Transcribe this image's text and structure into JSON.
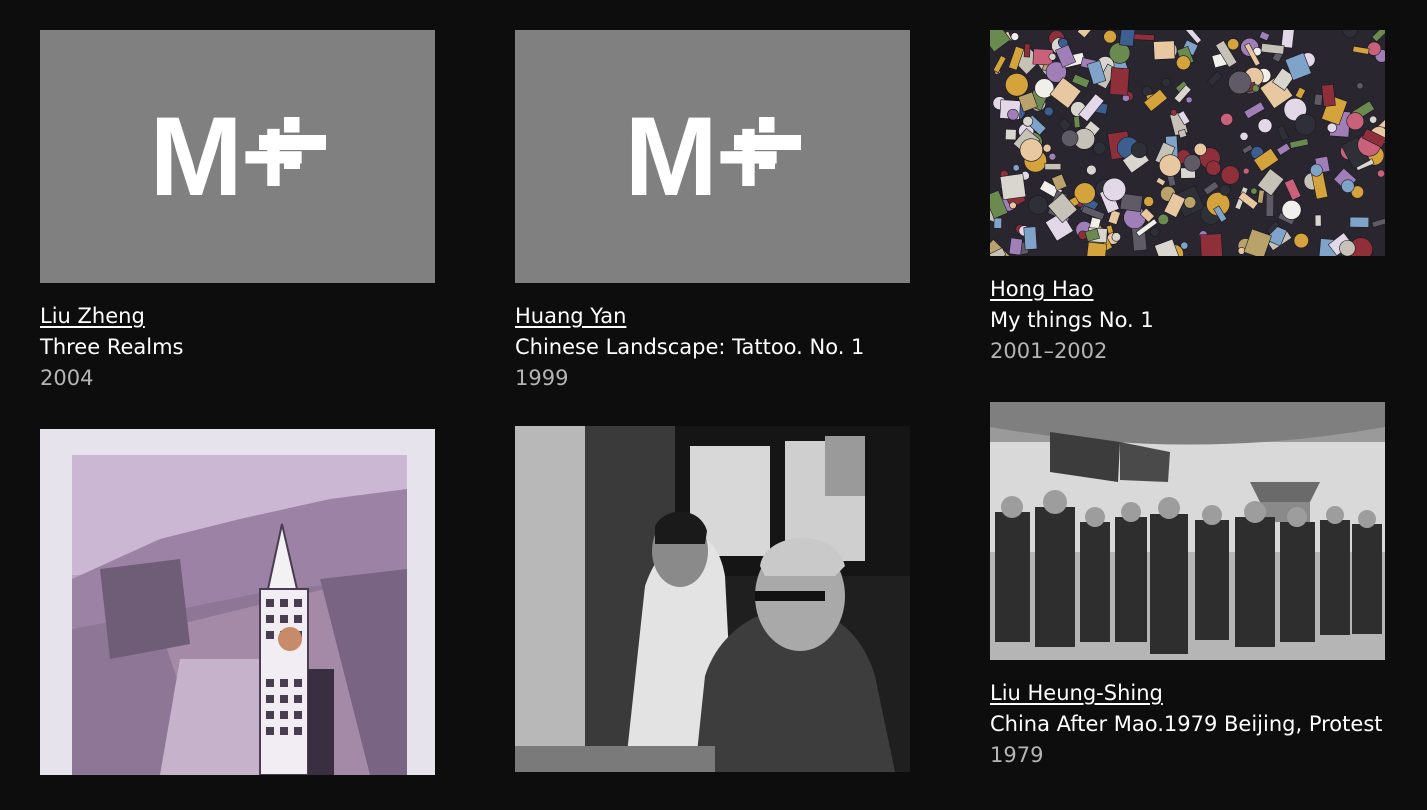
{
  "placeholder_logo": "M+",
  "colors": {
    "background": "#0d0d0d",
    "placeholder": "#808080",
    "text": "#ffffff",
    "year": "#b5b5b5"
  },
  "cards": [
    {
      "artist": "Liu Zheng",
      "title": "Three Realms",
      "year": "2004",
      "image": "m-plus-placeholder"
    },
    {
      "artist": "Huang Yan",
      "title": "Chinese Landscape: Tattoo. No. 1",
      "year": "1999",
      "image": "m-plus-placeholder"
    },
    {
      "artist": "Hong Hao",
      "title": "My things No. 1",
      "year": "2001–2002",
      "image": "collage-of-objects-photo"
    },
    {
      "artist": "Liu Heung-Shing",
      "title": "China After Mao.1979 Beijing, Protest",
      "year": "1979",
      "image": "bw-protest-photo"
    },
    {
      "image": "great-wall-costume-photo"
    },
    {
      "image": "bw-painters-studio-photo"
    }
  ]
}
